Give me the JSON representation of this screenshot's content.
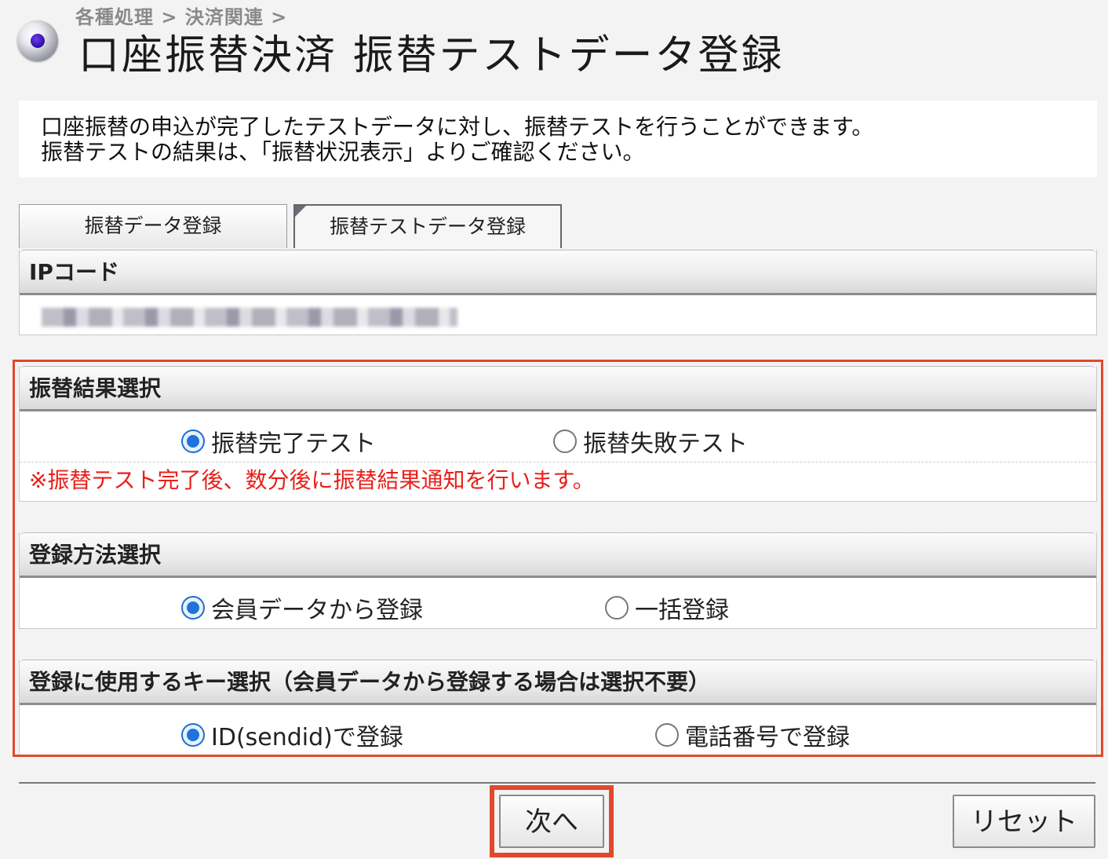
{
  "breadcrumb": "各種処理 > 決済関連 >",
  "page_title": "口座振替決済 振替テストデータ登録",
  "description": {
    "line1": "口座振替の申込が完了したテストデータに対し、振替テストを行うことができます。",
    "line2": "振替テストの結果は、「振替状況表示」よりご確認ください。"
  },
  "tabs": [
    {
      "label": "振替データ登録",
      "active": false
    },
    {
      "label": "振替テストデータ登録",
      "active": true
    }
  ],
  "ip_section": {
    "header": "IPコード"
  },
  "transfer_result": {
    "header": "振替結果選択",
    "options": [
      {
        "label": "振替完了テスト",
        "checked": true
      },
      {
        "label": "振替失敗テスト",
        "checked": false
      }
    ],
    "note": "※振替テスト完了後、数分後に振替結果通知を行います。"
  },
  "registration_method": {
    "header": "登録方法選択",
    "options": [
      {
        "label": "会員データから登録",
        "checked": true
      },
      {
        "label": "一括登録",
        "checked": false
      }
    ]
  },
  "registration_key": {
    "header": "登録に使用するキー選択（会員データから登録する場合は選択不要）",
    "options": [
      {
        "label": "ID(sendid)で登録",
        "checked": true
      },
      {
        "label": "電話番号で登録",
        "checked": false
      }
    ]
  },
  "buttons": {
    "next": "次へ",
    "reset": "リセット"
  },
  "colors": {
    "highlight": "#e1492c",
    "note_text": "#e8201a",
    "radio_checked": "#1e74dc"
  }
}
